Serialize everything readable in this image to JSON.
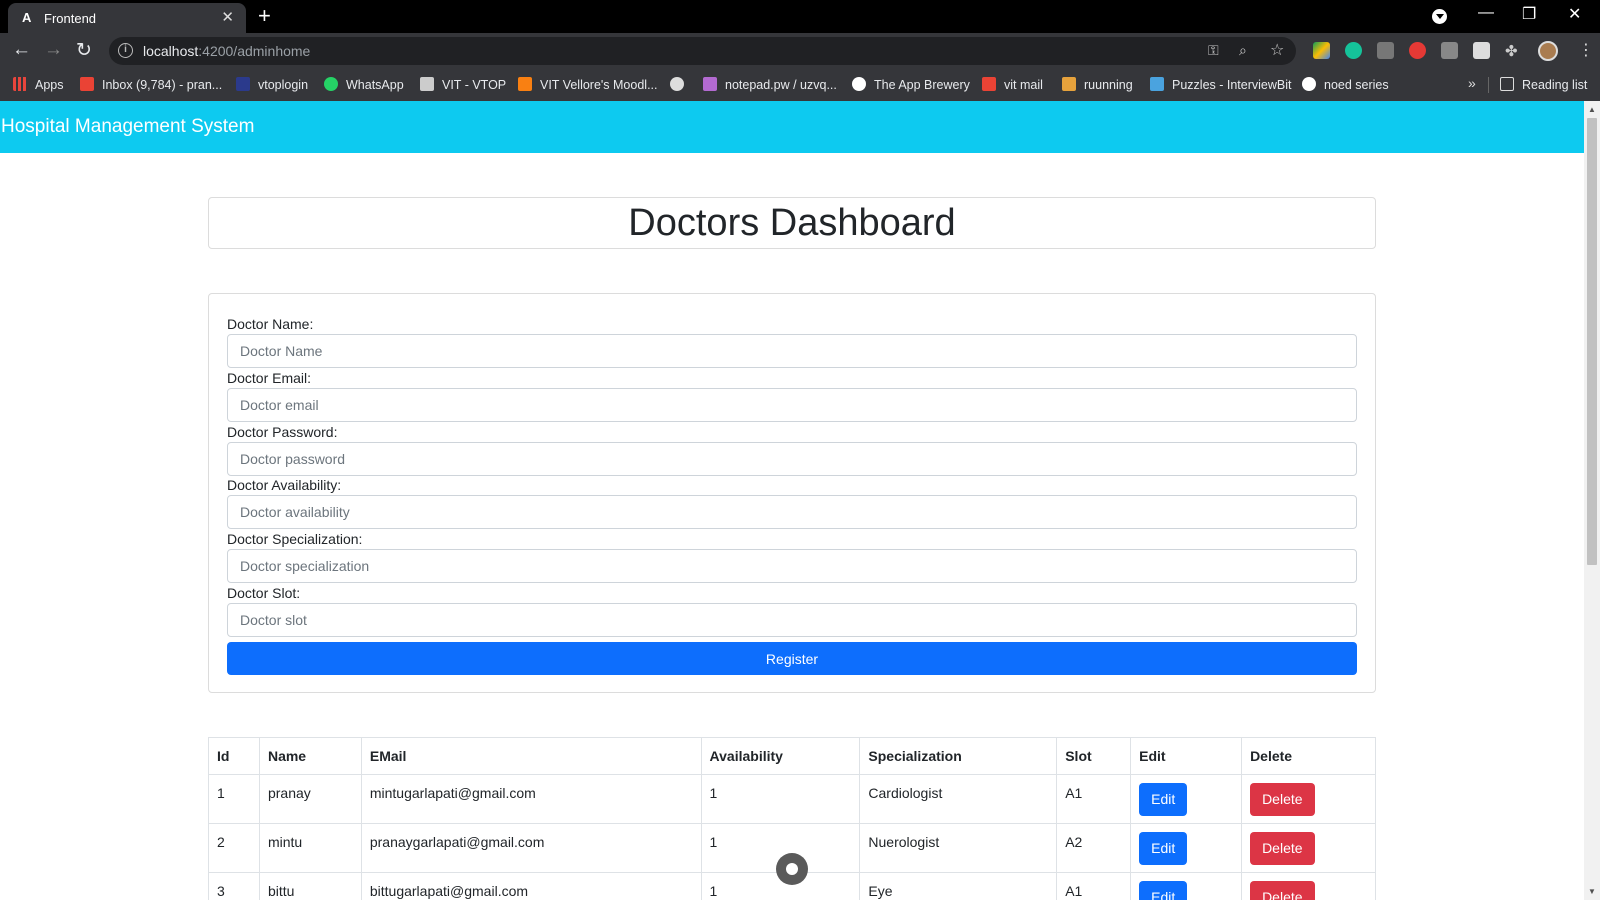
{
  "browser": {
    "tab_title": "Frontend",
    "tab_favicon": "A",
    "new_tab": "+",
    "url_host": "localhost",
    "url_path": ":4200/adminhome",
    "bookmarks": [
      {
        "label": "Apps",
        "icon": "apps-grid-icon",
        "color": "#e8453c"
      },
      {
        "label": "Inbox (9,784) - pran...",
        "icon": "gmail-icon",
        "color": "#ea4335"
      },
      {
        "label": "vtoplogin",
        "icon": "vtop-icon",
        "color": "#2b3a8c"
      },
      {
        "label": "WhatsApp",
        "icon": "whatsapp-icon",
        "color": "#25d366"
      },
      {
        "label": "VIT - VTOP",
        "icon": "vit-icon",
        "color": "#cccccc"
      },
      {
        "label": "VIT Vellore's Moodl...",
        "icon": "moodle-icon",
        "color": "#f98012"
      },
      {
        "label": "",
        "icon": "globe-icon",
        "color": "#dddddd"
      },
      {
        "label": "notepad.pw / uzvq...",
        "icon": "notepad-icon",
        "color": "#b36ad1"
      },
      {
        "label": "The App Brewery",
        "icon": "app-brewery-icon",
        "color": "#ffffff"
      },
      {
        "label": "vit mail",
        "icon": "gmail-icon",
        "color": "#ea4335"
      },
      {
        "label": "ruunning",
        "icon": "running-icon",
        "color": "#e6a23c"
      },
      {
        "label": "Puzzles - InterviewBit",
        "icon": "interviewbit-icon",
        "color": "#4aa3df"
      },
      {
        "label": "noed series",
        "icon": "github-icon",
        "color": "#ffffff"
      }
    ],
    "more_bookmarks": "»",
    "reading_list": "Reading list"
  },
  "navbar": {
    "brand": "Hospital Management System",
    "color": "#0dcaf0"
  },
  "dashboard": {
    "title": "Doctors Dashboard"
  },
  "form": {
    "fields": [
      {
        "label": "Doctor Name:",
        "placeholder": "Doctor Name"
      },
      {
        "label": "Doctor Email:",
        "placeholder": "Doctor email"
      },
      {
        "label": "Doctor Password:",
        "placeholder": "Doctor password"
      },
      {
        "label": "Doctor Availability:",
        "placeholder": "Doctor availability"
      },
      {
        "label": "Doctor Specialization:",
        "placeholder": "Doctor specialization"
      },
      {
        "label": "Doctor Slot:",
        "placeholder": "Doctor slot"
      }
    ],
    "submit_label": "Register"
  },
  "table": {
    "headers": [
      "Id",
      "Name",
      "EMail",
      "Availability",
      "Specialization",
      "Slot",
      "Edit",
      "Delete"
    ],
    "rows": [
      {
        "id": "1",
        "name": "pranay",
        "email": "mintugarlapati@gmail.com",
        "availability": "1",
        "specialization": "Cardiologist",
        "slot": "A1",
        "edit": "Edit",
        "delete": "Delete"
      },
      {
        "id": "2",
        "name": "mintu",
        "email": "pranaygarlapati@gmail.com",
        "availability": "1",
        "specialization": "Nuerologist",
        "slot": "A2",
        "edit": "Edit",
        "delete": "Delete"
      },
      {
        "id": "3",
        "name": "bittu",
        "email": "bittugarlapati@gmail.com",
        "availability": "1",
        "specialization": "Eye",
        "slot": "A1",
        "edit": "Edit",
        "delete": "Delete"
      }
    ]
  },
  "colors": {
    "primary": "#0d6efd",
    "danger": "#dc3545"
  }
}
